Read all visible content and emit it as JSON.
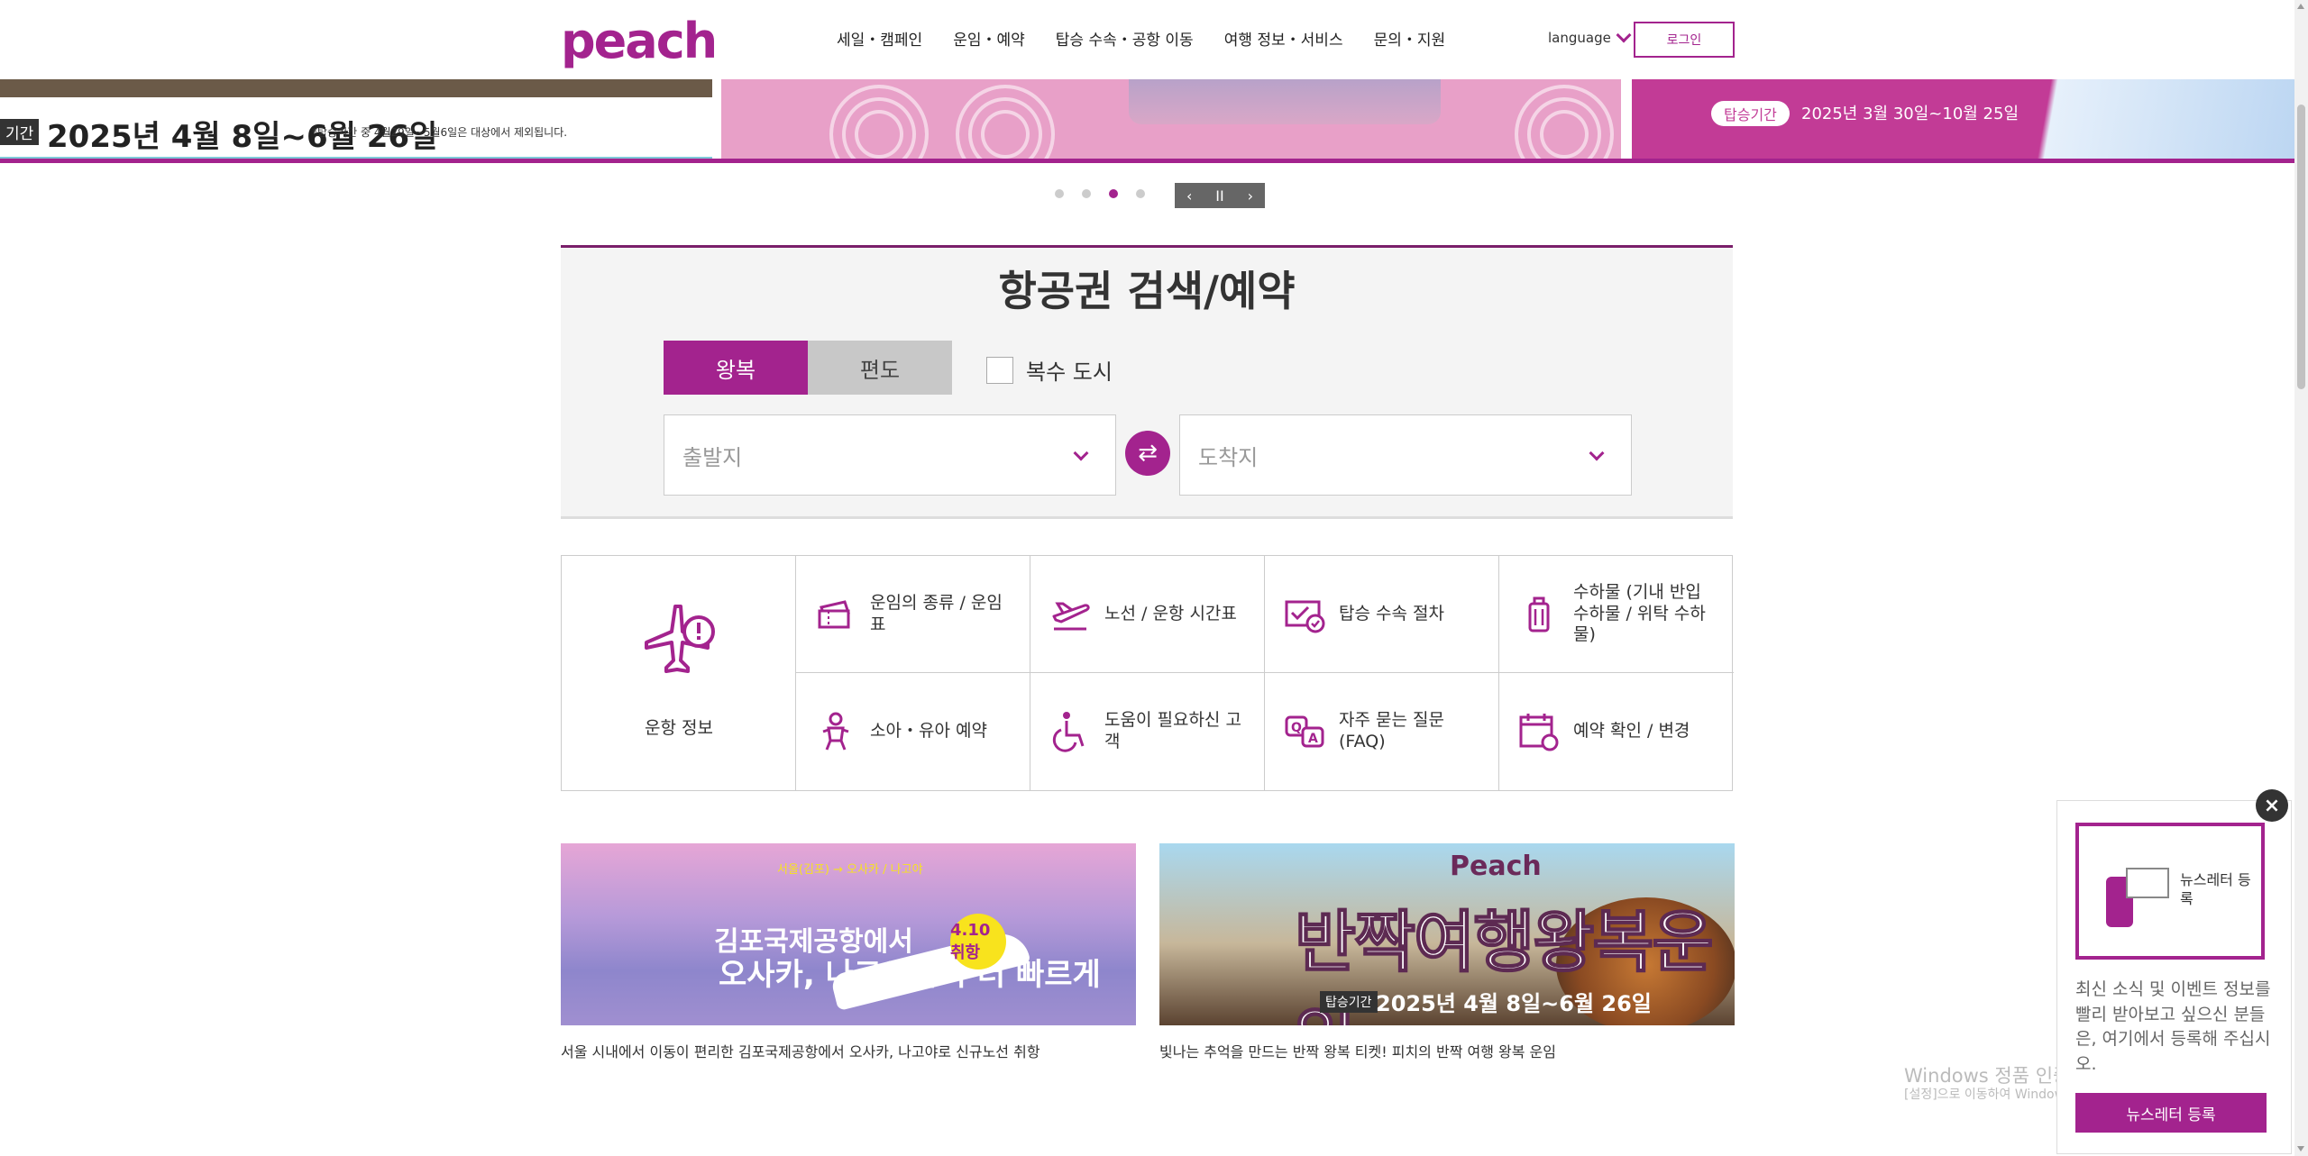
{
  "header": {
    "logo": "peach",
    "nav": [
      "세일・캠페인",
      "운임・예약",
      "탑승 수속・공항 이동",
      "여행 정보・서비스",
      "문의・지원"
    ],
    "language": "language",
    "login": "로그인"
  },
  "banner": {
    "slide1": {
      "tag": "기간",
      "date": "2025년 4월 8일~6월 26일",
      "note": "*탑승기간 중 4월29일~5월6일은 대상에서 제외됩니다."
    },
    "slide3": {
      "tag": "탑승기간",
      "date": "2025년 3월 30일~10월 25일"
    },
    "dots": 4,
    "active_dot": 3,
    "controls": {
      "prev": "‹",
      "pause": "II",
      "next": "›"
    }
  },
  "search": {
    "title": "항공권 검색/예약",
    "round_trip": "왕복",
    "one_way": "편도",
    "multi_city": "복수 도시",
    "departure_placeholder": "출발지",
    "arrival_placeholder": "도착지",
    "swap_icon": "⇄"
  },
  "quick_menu": {
    "main": "운항 정보",
    "items": [
      "운임의 종류 / 운임표",
      "노선 / 운항 시간표",
      "탑승 수속 절차",
      "수하물 (기내 반입 수하물 / 위탁 수하물)",
      "소아・유아 예약",
      "도움이 필요하신 고객",
      "자주 묻는 질문 (FAQ)",
      "예약 확인 / 변경"
    ]
  },
  "promos": {
    "card1": {
      "caption": "서울 시내에서 이동이 편리한 김포국제공항에서 오사카, 나고야로 신규노선 취항",
      "route": "서울(김포) → 오사카 / 나고야",
      "headline1": "김포국제공항에서",
      "headline2": "오사카, 나고야까지 더 빠르게",
      "badge": "4.10 취항"
    },
    "card2": {
      "caption": "빛나는 추억을 만드는 반짝 왕복 티켓! 피치의 반짝 여행 왕복 운임",
      "brand": "Peach",
      "headline": "반짝여행왕복운임",
      "tag": "탑승기간",
      "date": "2025년 4월 8일~6월 26일"
    }
  },
  "newsletter": {
    "close": "×",
    "box_label": "뉴스레터 등록",
    "description": "최신 소식 및 이벤트 정보를 빨리 받아보고 싶으신 분들은, 여기에서 등록해 주십시오.",
    "button": "뉴스레터 등록"
  },
  "watermark": {
    "line1": "Windows 정품 인증",
    "line2": "[설정]으로 이동하여 Windows를 정품 인증합니다."
  }
}
